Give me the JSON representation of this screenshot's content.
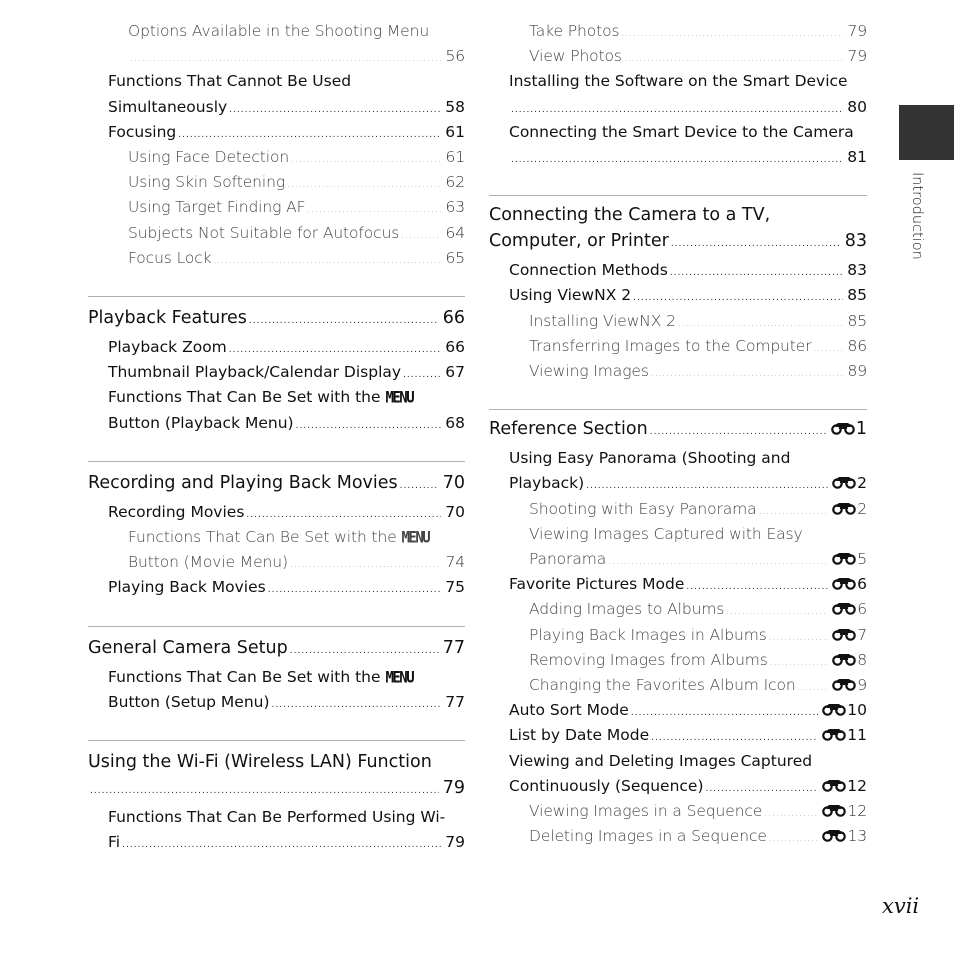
{
  "side_tab": {
    "label": "Introduction",
    "color": "#333333"
  },
  "page_number": "xvii",
  "left_column": {
    "entries": [
      {
        "level": 3,
        "lines": [
          "Options Available in the Shooting Menu",
          ""
        ],
        "page": "56"
      },
      {
        "level": 2,
        "lines": [
          "Functions That Cannot Be Used",
          "Simultaneously"
        ],
        "page": "58"
      },
      {
        "level": 2,
        "lines": [
          "Focusing"
        ],
        "page": "61"
      },
      {
        "level": 3,
        "lines": [
          "Using Face Detection"
        ],
        "page": "61"
      },
      {
        "level": 3,
        "lines": [
          "Using Skin Softening"
        ],
        "page": "62"
      },
      {
        "level": 3,
        "lines": [
          "Using Target Finding AF"
        ],
        "page": "63"
      },
      {
        "level": 3,
        "lines": [
          "Subjects Not Suitable for Autofocus"
        ],
        "page": "64"
      },
      {
        "level": 3,
        "lines": [
          "Focus Lock"
        ],
        "page": "65"
      },
      {
        "separator": true
      },
      {
        "level": 1,
        "lines": [
          "Playback Features"
        ],
        "page": "66"
      },
      {
        "level": 2,
        "lines": [
          "Playback Zoom"
        ],
        "page": "66"
      },
      {
        "level": 2,
        "lines": [
          "Thumbnail Playback/Calendar Display"
        ],
        "page": "67"
      },
      {
        "level": 2,
        "lines": [
          "Functions That Can Be Set with the |MENU|",
          "Button (Playback Menu)"
        ],
        "page": "68"
      },
      {
        "separator": true
      },
      {
        "level": 1,
        "lines": [
          "Recording and Playing Back Movies"
        ],
        "page": "70"
      },
      {
        "level": 2,
        "lines": [
          "Recording Movies"
        ],
        "page": "70"
      },
      {
        "level": 3,
        "lines": [
          "Functions That Can Be Set with the |MENU|",
          "Button (Movie Menu)"
        ],
        "page": "74"
      },
      {
        "level": 2,
        "lines": [
          "Playing Back Movies"
        ],
        "page": "75"
      },
      {
        "separator": true
      },
      {
        "level": 1,
        "lines": [
          "General Camera Setup"
        ],
        "page": "77"
      },
      {
        "level": 2,
        "lines": [
          "Functions That Can Be Set with the |MENU|",
          "Button (Setup Menu)"
        ],
        "page": "77"
      },
      {
        "separator": true
      },
      {
        "level": 1,
        "lines": [
          "Using the Wi-Fi (Wireless LAN) Function",
          ""
        ],
        "page": "79"
      },
      {
        "level": 2,
        "lines": [
          "Functions That Can Be Performed Using Wi-",
          "Fi"
        ],
        "page": "79"
      }
    ]
  },
  "right_column": {
    "entries": [
      {
        "level": 3,
        "lines": [
          "Take Photos"
        ],
        "page": "79"
      },
      {
        "level": 3,
        "lines": [
          "View Photos"
        ],
        "page": "79"
      },
      {
        "level": 2,
        "lines": [
          "Installing the Software on the Smart Device",
          ""
        ],
        "page": "80"
      },
      {
        "level": 2,
        "lines": [
          "Connecting the Smart Device to the Camera",
          ""
        ],
        "page": "81"
      },
      {
        "separator": true
      },
      {
        "level": 1,
        "lines": [
          "Connecting the Camera to a TV,",
          "Computer, or Printer"
        ],
        "page": "83"
      },
      {
        "level": 2,
        "lines": [
          "Connection Methods"
        ],
        "page": "83"
      },
      {
        "level": 2,
        "lines": [
          "Using ViewNX 2"
        ],
        "page": "85"
      },
      {
        "level": 3,
        "lines": [
          "Installing ViewNX 2"
        ],
        "page": "85"
      },
      {
        "level": 3,
        "lines": [
          "Transferring Images to the Computer"
        ],
        "page": "86"
      },
      {
        "level": 3,
        "lines": [
          "Viewing Images"
        ],
        "page": "89"
      },
      {
        "separator": true
      },
      {
        "level": 1,
        "lines": [
          "Reference Section"
        ],
        "page": "1",
        "ref": true
      },
      {
        "level": 2,
        "lines": [
          "Using Easy Panorama (Shooting and",
          "Playback)"
        ],
        "page": "2",
        "ref": true
      },
      {
        "level": 3,
        "lines": [
          "Shooting with Easy Panorama"
        ],
        "page": "2",
        "ref": true
      },
      {
        "level": 3,
        "lines": [
          "Viewing Images Captured with Easy",
          "Panorama"
        ],
        "page": "5",
        "ref": true
      },
      {
        "level": 2,
        "lines": [
          "Favorite Pictures Mode"
        ],
        "page": "6",
        "ref": true
      },
      {
        "level": 3,
        "lines": [
          "Adding Images to Albums"
        ],
        "page": "6",
        "ref": true
      },
      {
        "level": 3,
        "lines": [
          "Playing Back Images in Albums"
        ],
        "page": "7",
        "ref": true
      },
      {
        "level": 3,
        "lines": [
          "Removing Images from Albums"
        ],
        "page": "8",
        "ref": true
      },
      {
        "level": 3,
        "lines": [
          "Changing the Favorites Album Icon"
        ],
        "page": "9",
        "ref": true
      },
      {
        "level": 2,
        "lines": [
          "Auto Sort Mode"
        ],
        "page": "10",
        "ref": true
      },
      {
        "level": 2,
        "lines": [
          "List by Date Mode"
        ],
        "page": "11",
        "ref": true
      },
      {
        "level": 2,
        "lines": [
          "Viewing and Deleting Images Captured",
          "Continuously (Sequence)"
        ],
        "page": "12",
        "ref": true
      },
      {
        "level": 3,
        "lines": [
          "Viewing Images in a Sequence"
        ],
        "page": "12",
        "ref": true
      },
      {
        "level": 3,
        "lines": [
          "Deleting Images in a Sequence"
        ],
        "page": "13",
        "ref": true
      }
    ]
  }
}
